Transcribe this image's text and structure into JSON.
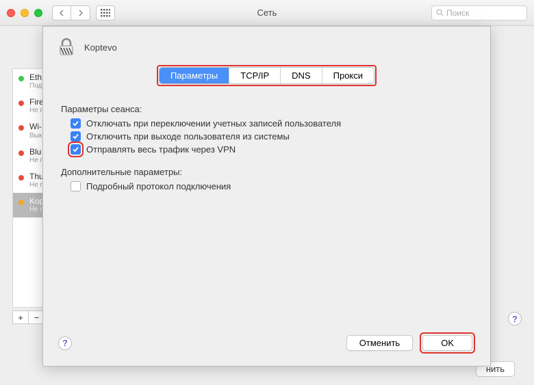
{
  "window": {
    "title": "Сеть",
    "search_placeholder": "Поиск"
  },
  "sidebar": {
    "items": [
      {
        "label": "Eth",
        "sub": "Под",
        "status": "green"
      },
      {
        "label": "Fire",
        "sub": "Не п",
        "status": "red"
      },
      {
        "label": "Wi-",
        "sub": "Вык",
        "status": "red"
      },
      {
        "label": "Blu",
        "sub": "Не п",
        "status": "red"
      },
      {
        "label": "Thu",
        "sub": "Не п",
        "status": "red"
      },
      {
        "label": "Kop",
        "sub": "Не п",
        "status": "orange"
      }
    ]
  },
  "bg_button": "нить",
  "sheet": {
    "title": "Koptevo",
    "tabs": [
      "Параметры",
      "TCP/IP",
      "DNS",
      "Прокси"
    ],
    "active_tab": 0,
    "section_session": "Параметры сеанса:",
    "opts_session": [
      {
        "label": "Отключать при переключении учетных записей пользователя",
        "checked": true,
        "highlight": false
      },
      {
        "label": "Отключить при выходе пользователя из системы",
        "checked": true,
        "highlight": false
      },
      {
        "label": "Отправлять весь трафик через VPN",
        "checked": true,
        "highlight": true
      }
    ],
    "section_extra": "Дополнительные параметры:",
    "opts_extra": [
      {
        "label": "Подробный протокол подключения",
        "checked": false
      }
    ],
    "cancel": "Отменить",
    "ok": "OK"
  }
}
